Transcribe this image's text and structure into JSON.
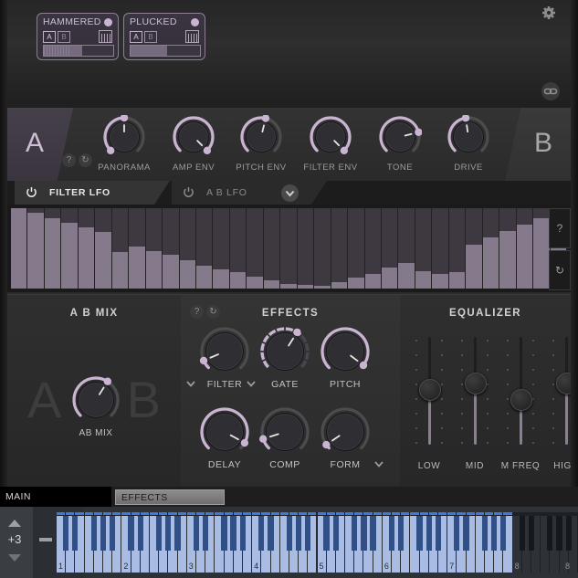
{
  "header": {
    "gear_icon": "gear-icon",
    "link_icon": "link-icon",
    "presets": [
      {
        "name": "HAMMERED",
        "slot_a": "A",
        "slot_b": "B",
        "level_pct": 55,
        "dotted_pct": 38,
        "keyboard_icon": "keyboard-icon",
        "led": "on"
      },
      {
        "name": "PLUCKED",
        "slot_a": "A",
        "slot_b": "B",
        "level_pct": 52,
        "dotted_pct": 0,
        "keyboard_icon": "keyboard-icon",
        "led": "on"
      }
    ]
  },
  "ab_row": {
    "panel_a_label": "A",
    "panel_b_label": "B",
    "help_icon": "help-icon",
    "reset_icon": "reset-icon",
    "knobs": [
      {
        "label": "PANORAMA",
        "value_pct": 50,
        "type": "bipolar"
      },
      {
        "label": "AMP ENV",
        "value_pct": 100,
        "type": "unipolar"
      },
      {
        "label": "PITCH ENV",
        "value_pct": 55,
        "type": "unipolar"
      },
      {
        "label": "FILTER ENV",
        "value_pct": 100,
        "type": "unipolar"
      },
      {
        "label": "TONE",
        "value_pct": 78,
        "type": "unipolar"
      },
      {
        "label": "DRIVE",
        "value_pct": 47,
        "type": "unipolar"
      }
    ]
  },
  "lfo": {
    "tabs": [
      {
        "label": "FILTER LFO",
        "active": true,
        "power_icon": "power-icon",
        "power_on": true
      },
      {
        "label": "A B LFO",
        "active": false,
        "power_icon": "power-icon",
        "power_on": false
      }
    ],
    "dropdown_icon": "chevron-down-icon",
    "help_icon": "help-icon",
    "reset_icon": "reset-icon",
    "selected_step": 0,
    "steps": [
      100,
      94,
      88,
      82,
      76,
      70,
      46,
      52,
      47,
      42,
      35,
      28,
      24,
      20,
      15,
      10,
      6,
      4,
      3,
      8,
      14,
      18,
      26,
      32,
      22,
      18,
      20,
      55,
      64,
      72,
      80,
      88,
      96
    ]
  },
  "mix": {
    "title": "A B MIX",
    "ghost_a": "A",
    "ghost_b": "B",
    "knob": {
      "label": "AB MIX",
      "value_pct": 62
    }
  },
  "effects": {
    "title": "EFFECTS",
    "help_icon": "help-icon",
    "reset_icon": "reset-icon",
    "knobs": [
      {
        "label": "FILTER",
        "value_pct": 8,
        "has_menu": true,
        "menu_icon": "chevron-down-icon",
        "style": "arc"
      },
      {
        "label": "GATE",
        "value_pct": 62,
        "has_menu": true,
        "menu_icon": "chevron-down-icon",
        "style": "dashed"
      },
      {
        "label": "PITCH",
        "value_pct": 97,
        "has_menu": false,
        "style": "arc"
      },
      {
        "label": "DELAY",
        "value_pct": 94,
        "has_menu": false,
        "style": "arc"
      },
      {
        "label": "COMP",
        "value_pct": 10,
        "has_menu": false,
        "style": "arc"
      },
      {
        "label": "FORM",
        "value_pct": 4,
        "has_menu": true,
        "menu_icon": "chevron-down-icon",
        "style": "arc"
      }
    ]
  },
  "equalizer": {
    "title": "EQUALIZER",
    "sliders": [
      {
        "label": "LOW",
        "value_pct": 52
      },
      {
        "label": "MID",
        "value_pct": 58
      },
      {
        "label": "M FREQ",
        "value_pct": 42
      },
      {
        "label": "HIGH",
        "value_pct": 58
      }
    ]
  },
  "host": {
    "tabs": [
      {
        "label": "MAIN",
        "active": true
      },
      {
        "label": "EFFECTS",
        "active": false
      }
    ],
    "octave": {
      "value": "+3",
      "up_icon": "triangle-up-icon",
      "down_icon": "triangle-down-icon"
    },
    "keyboard": {
      "octave_labels": [
        "1",
        "2",
        "3",
        "4",
        "5",
        "6",
        "7",
        "8"
      ],
      "active_octaves": 7,
      "total_octaves": 8
    }
  },
  "colors": {
    "accent": "#c9b4d2",
    "accent_dim": "#847a8c",
    "panel": "#2b2b2b",
    "key_active": "#a9bde4",
    "key_cap": "#3b7be0"
  }
}
